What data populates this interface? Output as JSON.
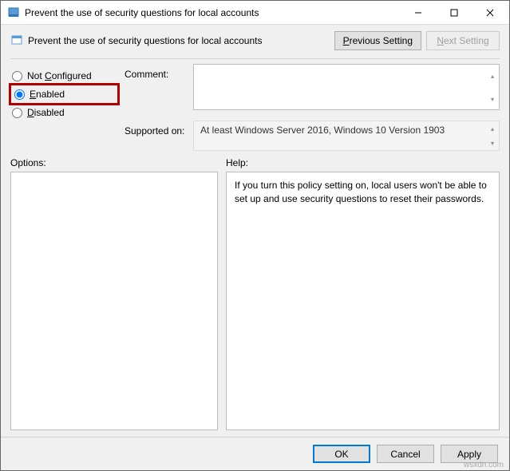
{
  "titlebar": {
    "title": "Prevent the use of security questions for local accounts"
  },
  "subheader": {
    "title": "Prevent the use of security questions for local accounts",
    "prev_label": "Previous Setting",
    "prev_hotkey": "P",
    "next_label": "Next Setting",
    "next_hotkey": "N"
  },
  "radios": {
    "not_configured": {
      "label": "Not Configured",
      "hotkey": "C",
      "checked": false
    },
    "enabled": {
      "label": "Enabled",
      "hotkey": "E",
      "checked": true
    },
    "disabled": {
      "label": "Disabled",
      "hotkey": "D",
      "checked": false
    }
  },
  "comment": {
    "label": "Comment:",
    "value": ""
  },
  "supported": {
    "label": "Supported on:",
    "value": "At least Windows Server 2016, Windows 10 Version 1903"
  },
  "panels": {
    "options_label": "Options:",
    "help_label": "Help:",
    "help_text": "If you turn this policy setting on, local users won't be able to set up and use security questions to reset their passwords."
  },
  "footer": {
    "ok": "OK",
    "cancel": "Cancel",
    "apply": "Apply"
  },
  "watermark": "wsxdn.com"
}
